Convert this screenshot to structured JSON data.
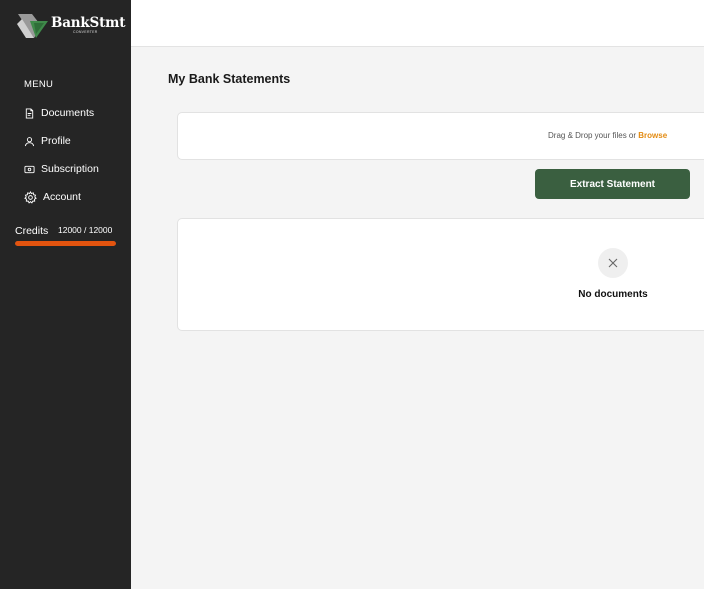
{
  "brand": {
    "name": "BankStmt",
    "tagline": "CONVERTER"
  },
  "sidebar": {
    "menu_label": "MENU",
    "items": [
      {
        "label": "Documents",
        "icon": "document-icon"
      },
      {
        "label": "Profile",
        "icon": "user-icon"
      },
      {
        "label": "Subscription",
        "icon": "card-icon"
      },
      {
        "label": "Account",
        "icon": "gear-icon"
      }
    ],
    "credits": {
      "label": "Credits",
      "value": "12000 / 12000",
      "fraction_used": 1.0,
      "bar_color": "#e3540f"
    }
  },
  "main": {
    "title": "My Bank Statements",
    "upload": {
      "text": "Drag & Drop your files or",
      "link": "Browse",
      "link_color": "#e38b12"
    },
    "extract_button": {
      "label": "Extract Statement",
      "color": "#3a5f40"
    },
    "empty_state": {
      "icon": "close-icon",
      "text": "No documents"
    }
  }
}
